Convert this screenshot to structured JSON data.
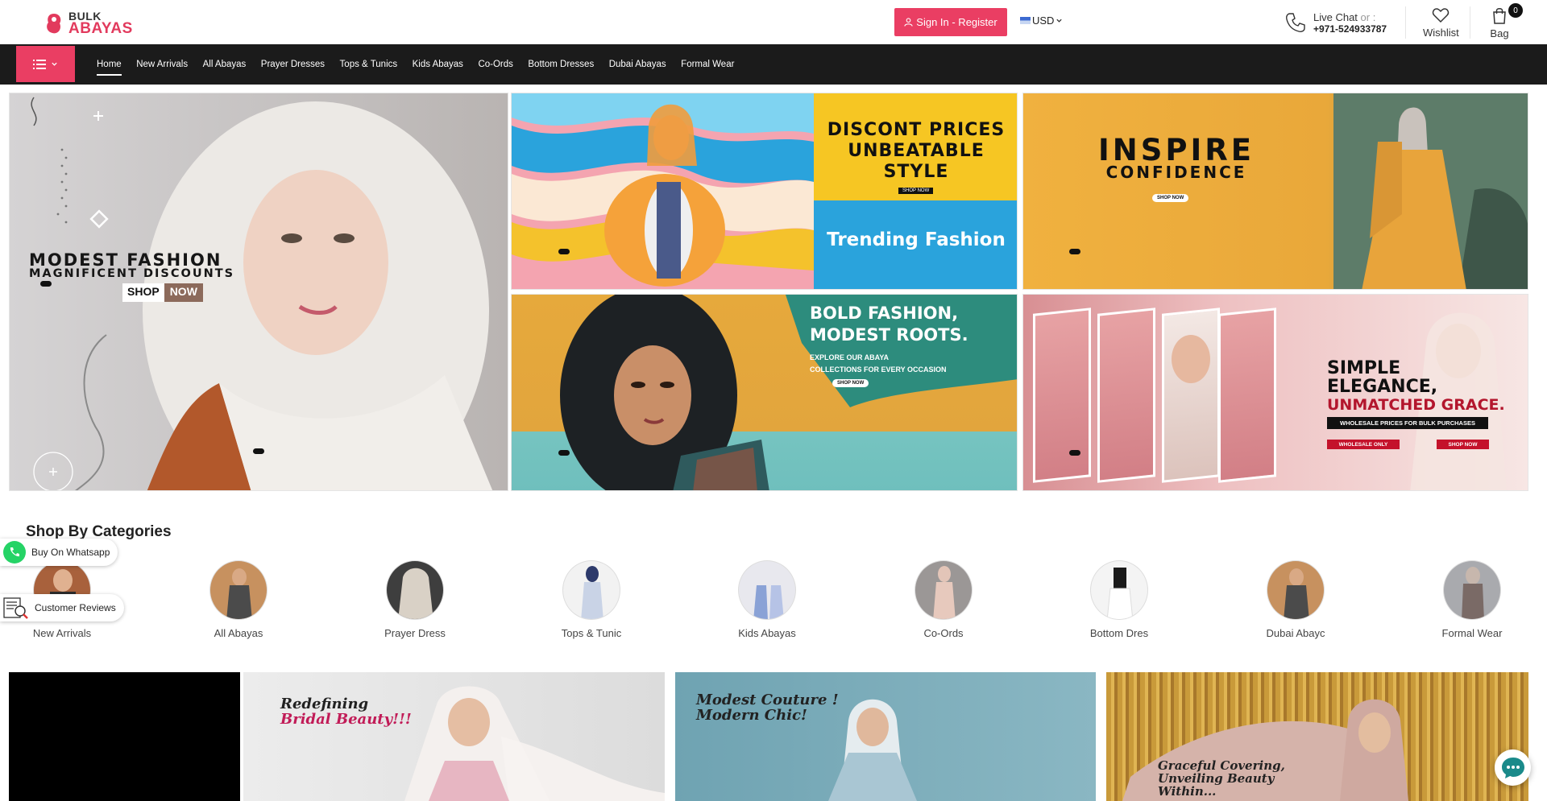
{
  "brand": {
    "line1": "BULK",
    "line2": "ABAYAS",
    "accent": "#ea3e63"
  },
  "header": {
    "signin_label": "Sign In - Register",
    "currency": "USD",
    "livechat_label": "Live Chat",
    "livechat_or": "or :",
    "phone": "+971-524933787",
    "wishlist_label": "Wishlist",
    "bag_label": "Bag",
    "bag_count": "0",
    "icons": [
      "user-icon",
      "flag-icon",
      "chevron-down-icon",
      "phone-icon",
      "heart-icon",
      "bag-icon"
    ]
  },
  "nav": {
    "menu_icon": "list-icon",
    "items": [
      "Home",
      "New Arrivals",
      "All Abayas",
      "Prayer Dresses",
      "Tops & Tunics",
      "Kids Abayas",
      "Co-Ords",
      "Bottom Dresses",
      "Dubai Abayas",
      "Formal Wear"
    ],
    "active": "Home"
  },
  "banners": {
    "main": {
      "line1": "MODEST FASHION",
      "line2": "MAGNIFICENT DISCOUNTS",
      "shop": "SHOP",
      "now": "NOW"
    },
    "discount": {
      "line1": "DISCONT PRICES",
      "line2": "UNBEATABLE STYLE",
      "shop_now": "SHOP NOW",
      "line3": "Trending Fashion"
    },
    "inspire": {
      "line1": "INSPIRE",
      "line2": "CONFIDENCE",
      "shop_now": "SHOP NOW"
    },
    "bold": {
      "line1": "BOLD FASHION,",
      "line2": "MODEST ROOTS.",
      "sub1": "EXPLORE OUR ABAYA",
      "sub2": "COLLECTIONS FOR EVERY OCCASION",
      "shop_now": "SHOP NOW"
    },
    "elegance": {
      "line1": "SIMPLE",
      "line2": "ELEGANCE,",
      "line3": "UNMATCHED GRACE.",
      "pill": "WHOLESALE PRICES FOR BULK PURCHASES",
      "tag1": "WHOLESALE ONLY",
      "tag2": "SHOP NOW"
    }
  },
  "categories": {
    "title": "Shop By Categories",
    "items": [
      "New Arrivals",
      "All Abayas",
      "Prayer Dress",
      "Tops & Tunic",
      "Kids Abayas",
      "Co-Ords",
      "Bottom Dres",
      "Dubai Abayc",
      "Formal Wear"
    ]
  },
  "floating": {
    "whatsapp": "Buy On Whatsapp",
    "reviews": "Customer Reviews"
  },
  "promos": {
    "bridal": {
      "line1": "Redefining",
      "line2": "Bridal Beauty!!!"
    },
    "couture": {
      "line1": "Modest Couture !",
      "line2": "Modern Chic!"
    },
    "grace": {
      "line1": "Graceful Covering,",
      "line2": "Unveiling Beauty",
      "line3": "Within..."
    }
  }
}
